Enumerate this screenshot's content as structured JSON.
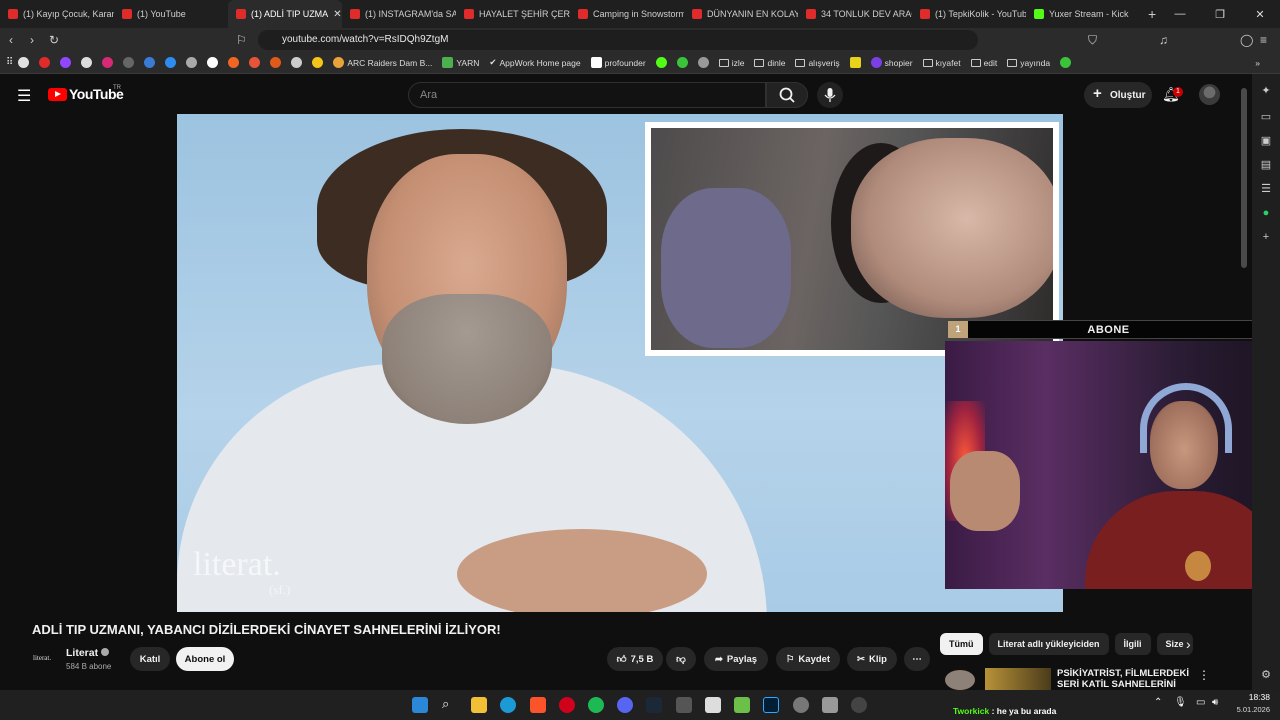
{
  "browser": {
    "tabs": [
      {
        "label": "(1) Kayıp Çocuk, Karan",
        "icon": "youtube",
        "active": false
      },
      {
        "label": "(1) YouTube",
        "icon": "youtube",
        "active": false
      },
      {
        "label": "(1) ADLİ TIP UZMA",
        "icon": "youtube",
        "active": true
      },
      {
        "label": "(1) INSTAGRAM'da SA",
        "icon": "youtube",
        "active": false
      },
      {
        "label": "HAYALET ŞEHİR ÇERNO",
        "icon": "youtube",
        "active": false
      },
      {
        "label": "Camping in Snowstorm",
        "icon": "youtube",
        "active": false
      },
      {
        "label": "DÜNYANIN EN KOLAY",
        "icon": "youtube",
        "active": false
      },
      {
        "label": "34 TONLUK DEV ARAÇ",
        "icon": "youtube",
        "active": false
      },
      {
        "label": "(1) TepkiKolik - YouTub",
        "icon": "youtube",
        "active": false
      },
      {
        "label": "Yuxer Stream - Kick",
        "icon": "kick",
        "active": false
      }
    ],
    "url": "youtube.com/watch?v=RsIDQh9ZtgM",
    "bookmarks": [
      {
        "label": "ARC Raiders Dam B...",
        "type": "link"
      },
      {
        "label": "YARN",
        "type": "link"
      },
      {
        "label": "AppWork Home page",
        "type": "link"
      },
      {
        "label": "profounder",
        "type": "link"
      },
      {
        "label": "izle",
        "type": "folder"
      },
      {
        "label": "dinle",
        "type": "folder"
      },
      {
        "label": "alışveriş",
        "type": "folder"
      },
      {
        "label": "shopier",
        "type": "link"
      },
      {
        "label": "kıyafet",
        "type": "folder"
      },
      {
        "label": "edit",
        "type": "folder"
      },
      {
        "label": "yayında",
        "type": "folder"
      }
    ]
  },
  "youtube": {
    "logo": "YouTube",
    "region": "TR",
    "search_placeholder": "Ara",
    "create_label": "Oluştur",
    "notification_count": "1"
  },
  "video": {
    "watermark": "literat.",
    "watermark_sub": "(sf.)",
    "title": "ADLİ TIP UZMANI, YABANCI DİZİLERDEKİ CİNAYET SAHNELERİNİ İZLİYOR!",
    "channel_logo": "literat.",
    "channel_name": "Literat",
    "subscribers": "584 B abone",
    "join_label": "Katıl",
    "subscribe_label": "Abone ol",
    "likes": "7,5 B",
    "share_label": "Paylaş",
    "save_label": "Kaydet",
    "clip_label": "Klip"
  },
  "overlay": {
    "sub_goal_left": "1",
    "sub_goal_label": "ABONE",
    "sub_goal_count": "15"
  },
  "sidebar_chips": [
    "Tümü",
    "Literat adlı yükleyiciden",
    "İlgili",
    "Size"
  ],
  "recommendation": {
    "title": "PSİKİYATRİST, FİLMLERDEKİ SERİ KATİL SAHNELERİNİ"
  },
  "taskbar": {
    "chat_user": "Tworkick",
    "chat_message": " : he ya bu arada",
    "time": "18:38",
    "date": "5.01.2026"
  },
  "colors": {
    "youtube_red": "#ff0000",
    "kick_green": "#53fc18",
    "background": "#0f0f0f"
  }
}
